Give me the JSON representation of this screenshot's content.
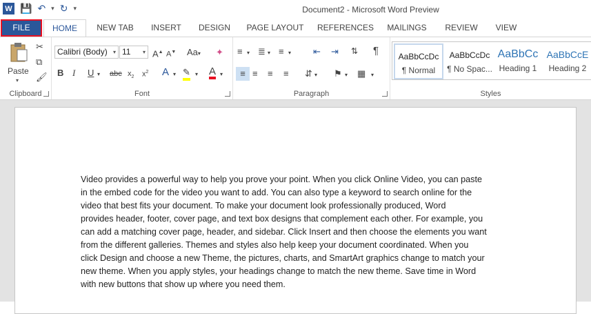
{
  "app": {
    "title": "Document2 - Microsoft Word Preview",
    "logo_letter": "W"
  },
  "tabs": [
    "FILE",
    "HOME",
    "NEW TAB",
    "INSERT",
    "DESIGN",
    "PAGE LAYOUT",
    "REFERENCES",
    "MAILINGS",
    "REVIEW",
    "VIEW"
  ],
  "ribbon": {
    "clipboard": {
      "paste_label": "Paste",
      "group_label": "Clipboard"
    },
    "font": {
      "font_name": "Calibri (Body)",
      "font_size": "11",
      "group_label": "Font"
    },
    "paragraph": {
      "group_label": "Paragraph"
    },
    "styles": {
      "group_label": "Styles",
      "items": [
        {
          "sample": "AaBbCcDc",
          "name": "¶ Normal"
        },
        {
          "sample": "AaBbCcDc",
          "name": "¶ No Spac..."
        },
        {
          "sample": "AaBbCc",
          "name": "Heading 1"
        },
        {
          "sample": "AaBbCcE",
          "name": "Heading 2"
        }
      ]
    }
  },
  "document": {
    "lines": [
      "Video provides a powerful way to help you prove your point. When you click Online Video, you can paste",
      "in the embed code for the video you want to add. You can also type a keyword to search online for the",
      "video that best fits your document. To make your document look professionally produced, Word",
      "provides header, footer, cover page, and text box designs that complement each other. For example, you",
      "can add a matching cover page, header, and sidebar. Click Insert and then choose the elements you want",
      "from the different galleries. Themes and styles also help keep your document coordinated. When you",
      "click Design and choose a new Theme, the pictures, charts, and SmartArt graphics change to match your",
      "new theme. When you apply styles, your headings change to match the new theme. Save time in Word",
      "with new buttons that show up where you need them."
    ]
  },
  "colors": {
    "accent": "#2b579a",
    "highlight_outline": "#e81123"
  }
}
